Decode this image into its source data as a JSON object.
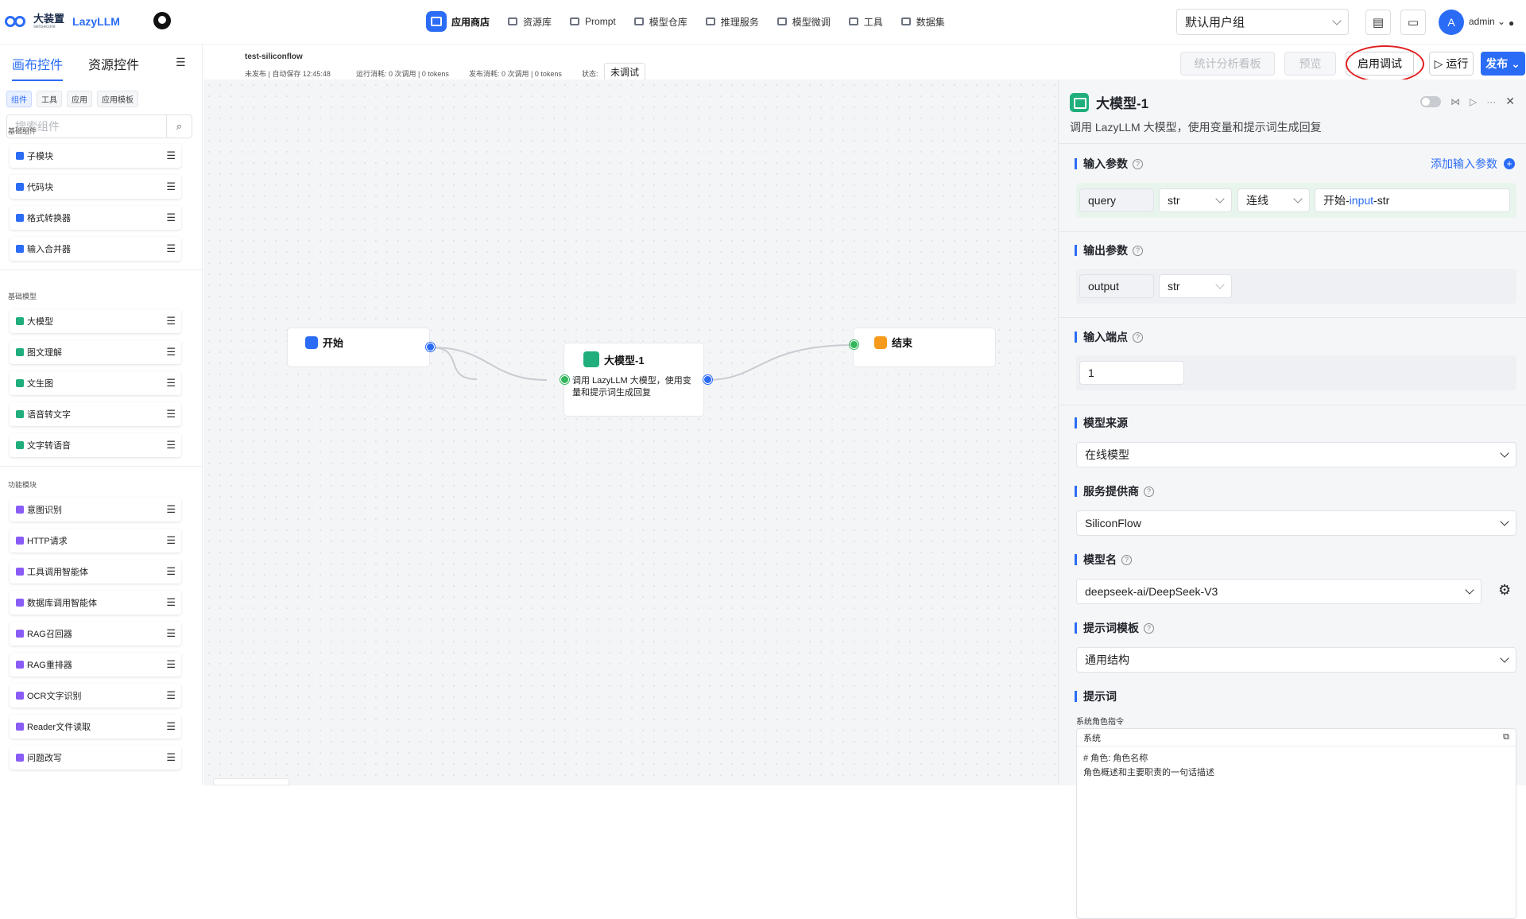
{
  "brand": {
    "cn": "大装置",
    "sub": "sensecore",
    "en": "LazyLLM"
  },
  "nav": [
    {
      "label": "应用商店",
      "icon": "store-icon",
      "active": true
    },
    {
      "label": "资源库",
      "icon": "grid-icon"
    },
    {
      "label": "Prompt",
      "icon": "prompt-icon"
    },
    {
      "label": "模型仓库",
      "icon": "cube-icon"
    },
    {
      "label": "推理服务",
      "icon": "inference-icon"
    },
    {
      "label": "模型微调",
      "icon": "finetune-icon"
    },
    {
      "label": "工具",
      "icon": "tools-icon"
    },
    {
      "label": "数据集",
      "icon": "dataset-icon"
    }
  ],
  "user_group": "默认用户组",
  "user": {
    "initial": "A",
    "name": "admin"
  },
  "left": {
    "tabs": [
      "画布控件",
      "资源控件"
    ],
    "chips": [
      "组件",
      "工具",
      "应用",
      "应用模板"
    ],
    "search_placeholder": "搜索组件",
    "sections": [
      {
        "title": "基础组件",
        "color": "#2b6cf6",
        "items": [
          "子模块",
          "代码块",
          "格式转换器",
          "输入合并器"
        ]
      },
      {
        "title": "基础模型",
        "color": "#1fae7c",
        "items": [
          "大模型",
          "图文理解",
          "文生图",
          "语音转文字",
          "文字转语音"
        ]
      },
      {
        "title": "功能模块",
        "color": "#8a5cf6",
        "items": [
          "意图识别",
          "HTTP请求",
          "工具调用智能体",
          "数据库调用智能体",
          "RAG召回器",
          "RAG重排器",
          "OCR文字识别",
          "Reader文件读取",
          "问题改写"
        ]
      }
    ]
  },
  "toolbar": {
    "app_name": "test-siliconflow",
    "saved": "未发布 | 自动保存 12:45:48",
    "run_cost": "运行消耗:  0 次调用 | 0 tokens",
    "pub_cost": "发布消耗:  0 次调用 | 0 tokens",
    "status_label": "状态:",
    "status": "未调试",
    "stats_btn": "统计分析看板",
    "preview_btn": "预览",
    "debug_btn": "启用调试",
    "run_btn": "▷ 运行",
    "publish_btn": "发布"
  },
  "canvas": {
    "start": "开始",
    "llm_title": "大模型-1",
    "llm_desc": "调用 LazyLLM 大模型，使用变量和提示词生成回复",
    "end": "结束"
  },
  "panel": {
    "title": "大模型-1",
    "desc": "调用 LazyLLM 大模型，使用变量和提示词生成回复",
    "input_params": "输入参数",
    "add_input": "添加输入参数",
    "input_row": {
      "name": "query",
      "type": "str",
      "mode": "连线",
      "src_a": "开始-",
      "src_b": "input",
      "src_c": "-str"
    },
    "output_params": "输出参数",
    "output_row": {
      "name": "output",
      "type": "str"
    },
    "input_ports": "输入端点",
    "input_ports_value": "1",
    "model_source": "模型来源",
    "model_source_value": "在线模型",
    "provider": "服务提供商",
    "provider_value": "SiliconFlow",
    "model_name": "模型名",
    "model_name_value": "deepseek-ai/DeepSeek-V3",
    "prompt_template": "提示词模板",
    "prompt_template_value": "通用结构",
    "prompt": "提示词",
    "system_instr": "系统角色指令",
    "system": "系统",
    "prompt_lines": [
      "# 角色: 角色名称",
      "角色概述和主要职责的一句话描述"
    ]
  }
}
